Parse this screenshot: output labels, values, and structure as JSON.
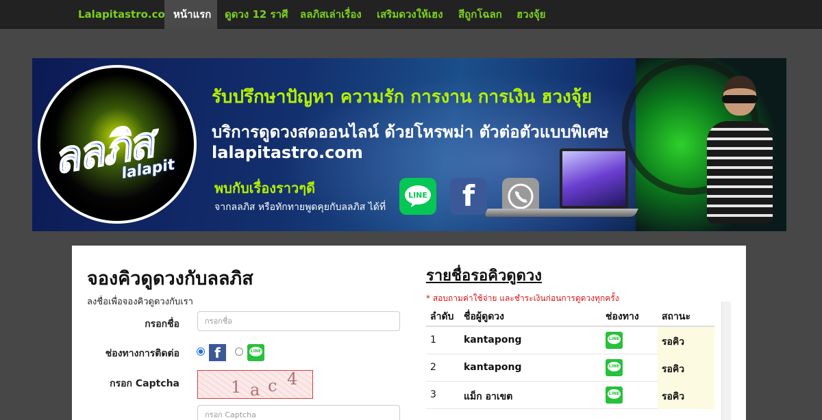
{
  "nav": {
    "brand": "Lalapitastro.com",
    "items": [
      {
        "label": "หน้าแรก",
        "active": true
      },
      {
        "label": "ดูดวง 12 ราศี",
        "active": false
      },
      {
        "label": "ลลภิสเล่าเรื่อง",
        "active": false
      },
      {
        "label": "เสริมดวงให้เฮง",
        "active": false
      },
      {
        "label": "สีถูกโฉลก",
        "active": false
      },
      {
        "label": "ฮวงจุ้ย",
        "active": false
      }
    ]
  },
  "banner": {
    "logo_thai": "ลลภิส",
    "logo_latin": "lalapit",
    "headline": "รับปรึกษาปัญหา ความรัก การงาน การเงิน ฮวงจุ้ย",
    "subhead": "บริการดูดวงสดออนไลน์ ด้วยโหรพม่า ตัวต่อตัวแบบพิเศษ",
    "url": "lalapitastro.com",
    "meet": "พบกับเรื่องราวๆดี",
    "contact": "จากลลภิส หรือทักทายพูดคุยกับลลภิส ได้ที่",
    "buttons": [
      "LINE",
      "f",
      "phone-icon"
    ]
  },
  "form": {
    "title": "จองคิวดูดวงกับลลภิส",
    "subtitle": "ลงชื่อเพื่อจองคิวดูดวงกับเรา",
    "name_label": "กรอกชื่อ",
    "name_placeholder": "กรอกชื่อ",
    "channel_label": "ช่องทางการติดต่อ",
    "channel_selected": "facebook",
    "captcha_label": "กรอก Captcha",
    "captcha_text": [
      "1",
      "a",
      "c",
      "4"
    ],
    "captcha_placeholder": "กรอก Captcha"
  },
  "queue": {
    "title": "รายชื่อรอคิวดูดวง",
    "note": "* สอบถามค่าใช้จ่าย และชำระเงินก่อนการดูดวงทุกครั้ง",
    "headers": [
      "ลำดับ",
      "ชื่อผู้ดูดวง",
      "ช่องทาง",
      "สถานะ"
    ],
    "rows": [
      {
        "no": "1",
        "name": "kantapong",
        "channel": "line",
        "status": "รอคิว"
      },
      {
        "no": "2",
        "name": "kantapong",
        "channel": "line",
        "status": "รอคิว"
      },
      {
        "no": "3",
        "name": "แม็ก อาเขต",
        "channel": "line",
        "status": "รอคิว"
      }
    ]
  },
  "colors": {
    "nav_bg": "#222222",
    "nav_text": "#7cd01f",
    "page_bg": "#474747",
    "line_green": "#27c13b",
    "facebook": "#3b5998",
    "note_red": "#d81313"
  }
}
